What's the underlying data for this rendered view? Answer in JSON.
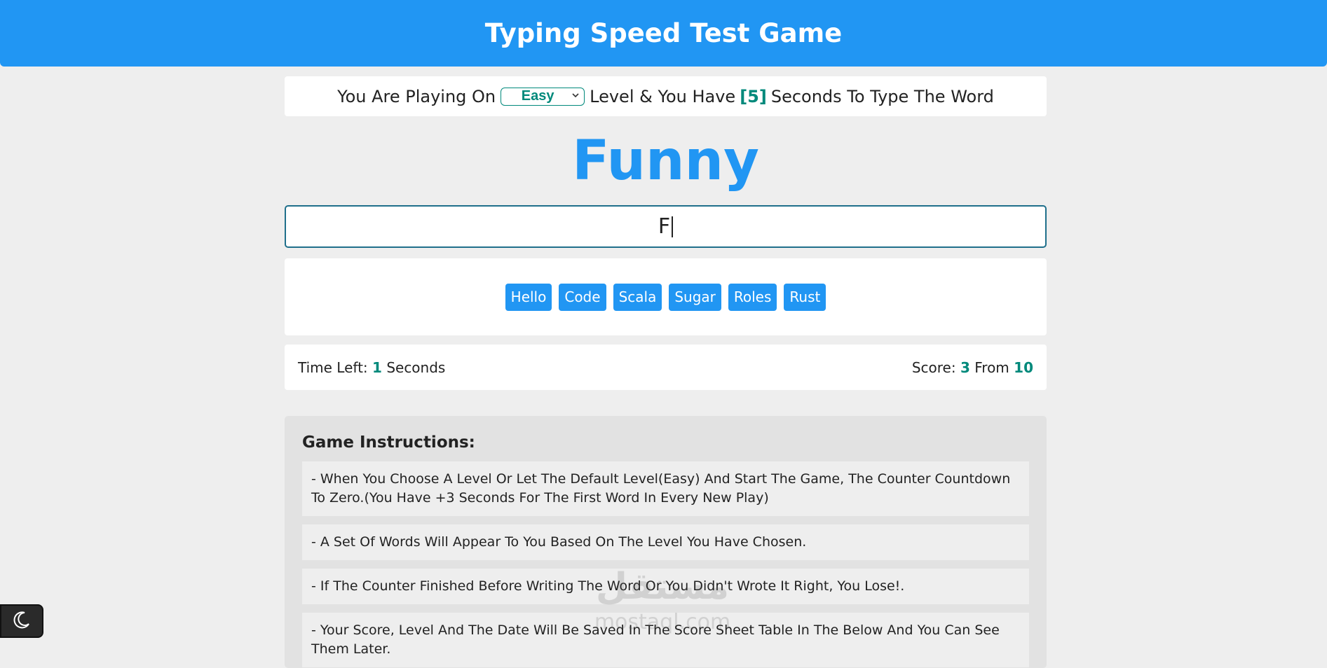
{
  "header": {
    "title": "Typing Speed Test Game"
  },
  "level_bar": {
    "prefix": "You Are Playing On",
    "selected_level": "Easy",
    "middle": "Level & You Have",
    "seconds": "[5]",
    "suffix": "Seconds To Type The Word"
  },
  "game": {
    "current_word": "Funny",
    "input_value": "F",
    "upcoming_words": [
      "Hello",
      "Code",
      "Scala",
      "Sugar",
      "Roles",
      "Rust"
    ]
  },
  "stats": {
    "time_label": "Time Left:",
    "time_value": "1",
    "time_unit": "Seconds",
    "score_label": "Score:",
    "score_value": "3",
    "score_from_label": "From",
    "score_total": "10"
  },
  "instructions": {
    "title": "Game Instructions:",
    "items": [
      "- When You Choose A Level Or Let The Default Level(Easy) And Start The Game, The Counter Countdown To Zero.(You Have +3 Seconds For The First Word In Every New Play)",
      "- A Set Of Words Will Appear To You Based On The Level You Have Chosen.",
      "- If The Counter Finished Before Writing The Word Or You Didn't Wrote It Right, You Lose!.",
      "- Your Score, Level And The Date Will Be Saved In The Score Sheet Table In The Below And You Can See Them Later."
    ]
  },
  "watermark": {
    "text_en": "mostaql.com",
    "text_ar": "مستقل"
  },
  "icons": {
    "theme_toggle": "moon-icon",
    "select_chevron": "chevron-down-icon"
  },
  "colors": {
    "accent": "#2196f3",
    "teal": "#00897b"
  }
}
